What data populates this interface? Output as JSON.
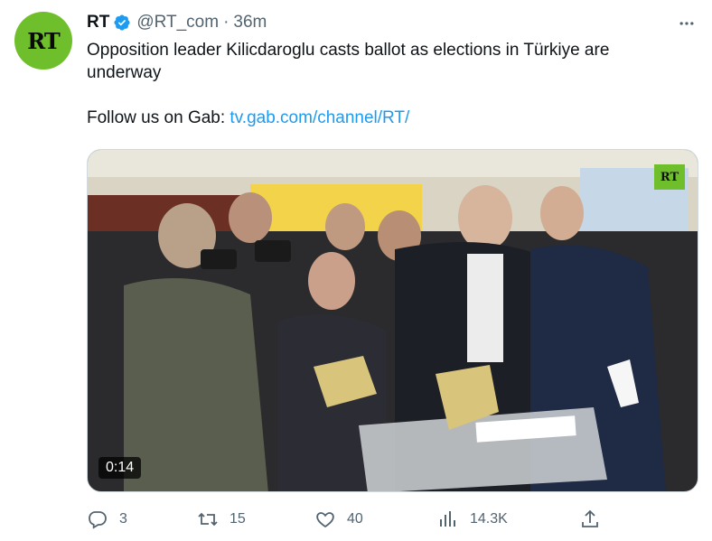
{
  "author": {
    "name": "RT",
    "handle": "@RT_com",
    "time": "36m",
    "avatar_text": "RT",
    "verified_color": "#1d9bf0",
    "avatar_color": "#6fbf2c"
  },
  "tweet": {
    "line1": "Opposition leader Kilicdaroglu casts ballot as elections in Türkiye are underway",
    "follow_prefix": "Follow us on Gab: ",
    "follow_link": "tv.gab.com/channel/RT/"
  },
  "media": {
    "duration": "0:14",
    "watermark": "RT"
  },
  "actions": {
    "replies": "3",
    "retweets": "15",
    "likes": "40",
    "views": "14.3K"
  },
  "colors": {
    "text": "#0f1419",
    "muted": "#536471",
    "link": "#1d9bf0"
  }
}
